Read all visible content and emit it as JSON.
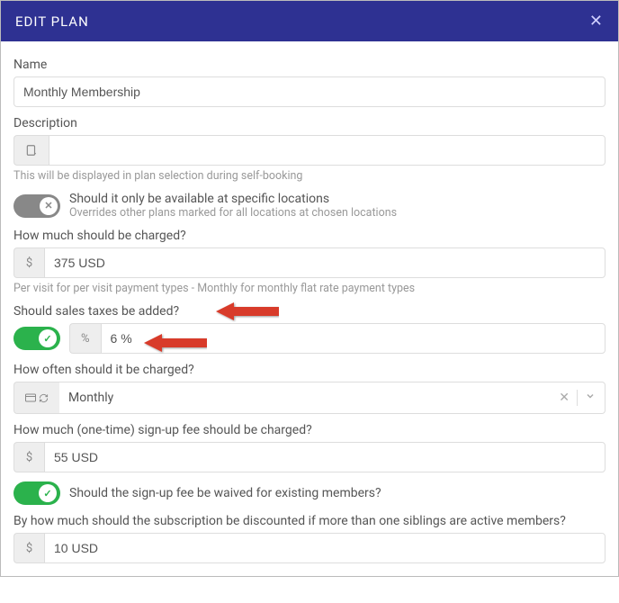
{
  "header": {
    "title": "EDIT PLAN"
  },
  "name": {
    "label": "Name",
    "value": "Monthly Membership"
  },
  "description": {
    "label": "Description",
    "value": "",
    "help": "This will be displayed in plan selection during self-booking"
  },
  "locations_toggle": {
    "state": "off",
    "knob_icon": "✕",
    "title": "Should it only be available at specific locations",
    "sub": "Overrides other plans marked for all locations at chosen locations"
  },
  "charge": {
    "label": "How much should be charged?",
    "addon": "$",
    "value": "375 USD",
    "help": "Per visit for per visit payment types - Monthly for monthly flat rate payment types"
  },
  "tax": {
    "label": "Should sales taxes be added?",
    "state": "on",
    "knob_icon": "✓",
    "addon": "%",
    "value": "6 %"
  },
  "frequency": {
    "label": "How often should it be charged?",
    "value": "Monthly"
  },
  "signup_fee": {
    "label": "How much (one-time) sign-up fee should be charged?",
    "addon": "$",
    "value": "55 USD"
  },
  "waive_toggle": {
    "state": "on",
    "knob_icon": "✓",
    "title": "Should the sign-up fee be waived for existing members?"
  },
  "sibling_discount": {
    "label": "By how much should the subscription be discounted if more than one siblings are active members?",
    "addon": "$",
    "value": "10 USD"
  }
}
